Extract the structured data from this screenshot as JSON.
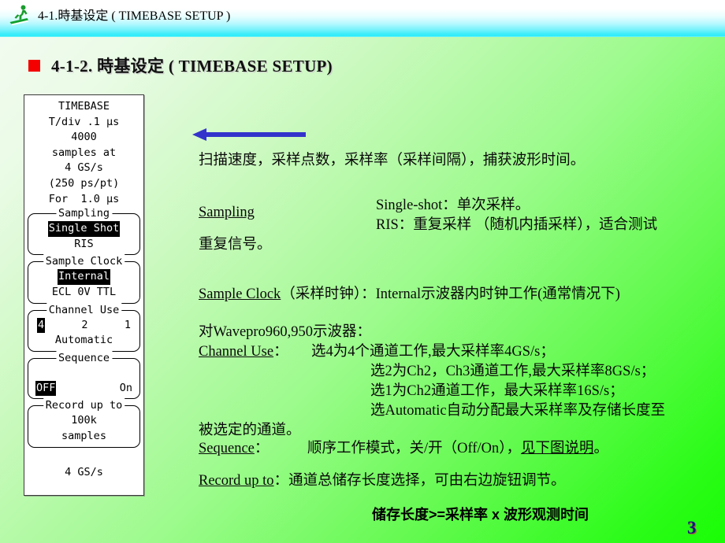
{
  "header": {
    "icon": "skier-logo-icon",
    "title": "4-1.時基设定 ( TIMEBASE SETUP )"
  },
  "subtitle": {
    "bullet_color": "#f40000",
    "text": "4-1-2. 時基设定 ( TIMEBASE SETUP)"
  },
  "scope_panel": {
    "title": "TIMEBASE",
    "readout_lines": [
      "T/div .1 µs",
      "4000",
      "samples at",
      "4 GS/s",
      "(250 ps/pt)",
      "For  1.0 µs"
    ],
    "groups": [
      {
        "legend": "Sampling",
        "rows": [
          {
            "style": "center",
            "items": [
              {
                "text": "Single Shot",
                "selected": true
              }
            ]
          },
          {
            "style": "center",
            "items": [
              {
                "text": "RIS",
                "selected": false
              }
            ]
          }
        ]
      },
      {
        "legend": "Sample Clock",
        "rows": [
          {
            "style": "center",
            "items": [
              {
                "text": "Internal",
                "selected": true
              }
            ]
          },
          {
            "style": "center",
            "items": [
              {
                "text": "ECL 0V TTL",
                "selected": false
              }
            ]
          }
        ]
      },
      {
        "legend": "Channel Use",
        "rows": [
          {
            "style": "spread",
            "items": [
              {
                "text": "4",
                "selected": true
              },
              {
                "text": "2",
                "selected": false
              },
              {
                "text": "1",
                "selected": false
              }
            ]
          },
          {
            "style": "center",
            "items": [
              {
                "text": "Automatic",
                "selected": false
              }
            ]
          }
        ]
      },
      {
        "legend": "Sequence",
        "rows": [
          {
            "style": "blank",
            "items": []
          },
          {
            "style": "spread-wide",
            "items": [
              {
                "text": "OFF",
                "selected": true
              },
              {
                "text": "On",
                "selected": false
              }
            ]
          }
        ]
      },
      {
        "legend": "Record up to",
        "rows": [
          {
            "style": "center",
            "items": [
              {
                "text": "100k",
                "selected": false
              }
            ]
          },
          {
            "style": "center",
            "items": [
              {
                "text": "samples",
                "selected": false
              }
            ]
          }
        ]
      }
    ],
    "footer": "4 GS/s"
  },
  "arrow": {
    "name": "blue-left-arrow",
    "color": "#3333cc",
    "direction": "left"
  },
  "body": {
    "intro": "扫描速度，采样点数，采样率（采样间隔），捕获波形时间。",
    "sampling_label": "Sampling",
    "sampling_line1": "Single-shot：单次采样。",
    "sampling_line2": "RIS：重复采样 （随机内插采样），适合测试",
    "sampling_line3": "重复信号。",
    "sample_clock_label": "Sample Clock",
    "sample_clock_rest": "（采样时钟）：Internal示波器内时钟工作(通常情况下)",
    "wavepro_line": "对Wavepro960,950示波器：",
    "channel_use_label": "Channel Use",
    "channel_use_colon": "：",
    "channel_use_line1": "选4为4个通道工作,最大采样率4GS/s；",
    "channel_use_line2": "选2为Ch2，Ch3通道工作,最大采样率8GS/s；",
    "channel_use_line3": "选1为Ch2通道工作，最大采样率16S/s；",
    "channel_use_line4": "选Automatic自动分配最大采样率及存储长度至",
    "channel_use_line5": "被选定的通道。",
    "sequence_label": "Sequence",
    "sequence_colon": "：",
    "sequence_rest_a": "顺序工作模式，关/开（Off/On），",
    "sequence_link": "见下图说明",
    "sequence_rest_b": "。",
    "record_label": "Record up to",
    "record_rest": "：通道总储存长度选择，可由右边旋钮调节。",
    "formula": "储存长度>=采样率 x 波形观测时间"
  },
  "page_number": "3"
}
